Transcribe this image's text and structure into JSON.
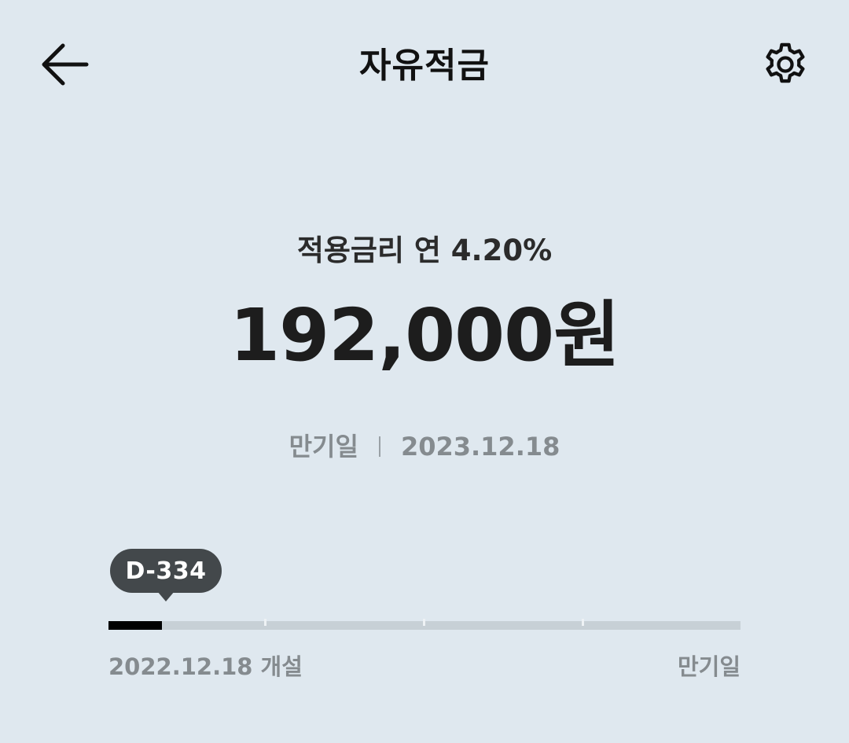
{
  "header": {
    "title": "자유적금",
    "back_icon": "arrow-left-icon",
    "settings_icon": "gear-icon"
  },
  "summary": {
    "rate_text": "적용금리 연 4.20%",
    "amount": "192,000원"
  },
  "maturity": {
    "label": "만기일",
    "date": "2023.12.18"
  },
  "progress": {
    "dday": "D-334",
    "elapsed_fraction": 0.085,
    "start_label": "2022.12.18 개설",
    "end_label": "만기일"
  },
  "colors": {
    "background": "#dfe8ef",
    "progress_fill": "#000000",
    "progress_track": "#c7d0d6",
    "bubble": "#43484b",
    "muted_text": "#858b8f"
  }
}
